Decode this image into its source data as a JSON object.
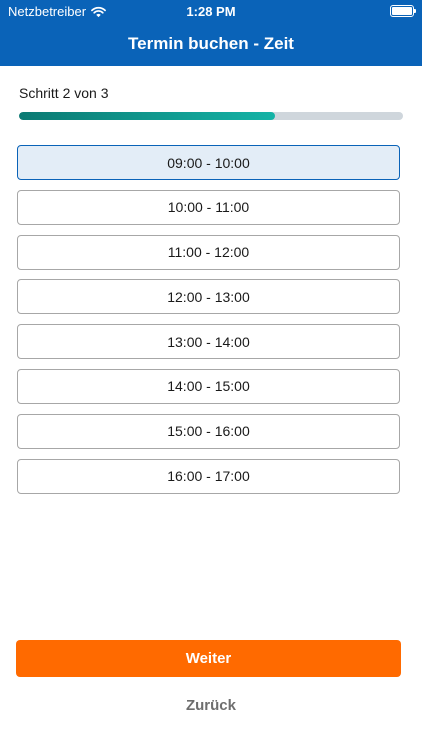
{
  "status_bar": {
    "carrier": "Netzbetreiber",
    "time": "1:28 PM"
  },
  "header": {
    "title": "Termin buchen - Zeit"
  },
  "progress": {
    "label": "Schritt 2 von 3",
    "fraction": 0.667
  },
  "slots": [
    {
      "label": "09:00 - 10:00",
      "selected": true
    },
    {
      "label": "10:00 - 11:00",
      "selected": false
    },
    {
      "label": "11:00 - 12:00",
      "selected": false
    },
    {
      "label": "12:00 - 13:00",
      "selected": false
    },
    {
      "label": "13:00 - 14:00",
      "selected": false
    },
    {
      "label": "14:00 - 15:00",
      "selected": false
    },
    {
      "label": "15:00 - 16:00",
      "selected": false
    },
    {
      "label": "16:00 - 17:00",
      "selected": false
    }
  ],
  "actions": {
    "next_label": "Weiter",
    "back_label": "Zurück"
  },
  "colors": {
    "header": "#0a63b8",
    "accent": "#ff6a00",
    "progress": "#14b3a6"
  }
}
